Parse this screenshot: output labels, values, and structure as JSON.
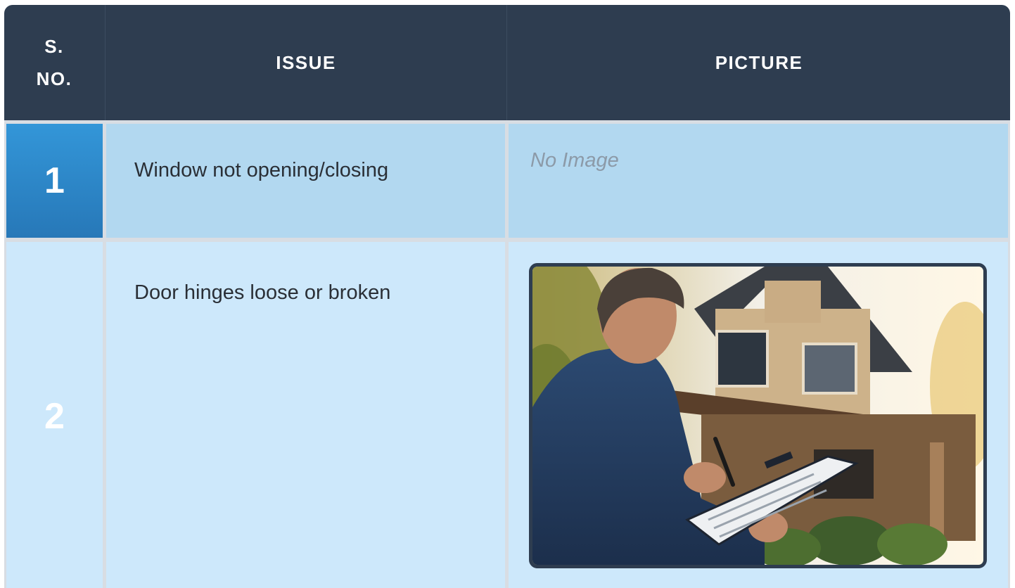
{
  "table": {
    "headers": {
      "sno": "S. NO.",
      "issue": "ISSUE",
      "picture": "PICTURE"
    },
    "rows": [
      {
        "sno": "1",
        "issue": "Window not opening/closing",
        "picture_placeholder": "No Image"
      },
      {
        "sno": "2",
        "issue": "Door hinges loose or broken",
        "picture": "inspector-with-clipboard-photo"
      }
    ]
  },
  "colors": {
    "header_bg": "#2e3d50",
    "sno_bg": "#2f8bd0",
    "row1_bg": "#b2d8f0",
    "row2_bg": "#cde8fb"
  }
}
